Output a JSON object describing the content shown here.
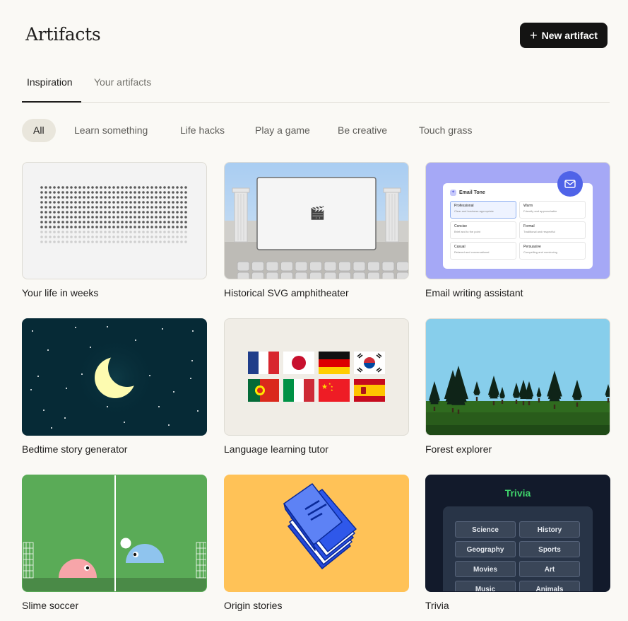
{
  "header": {
    "title": "Artifacts",
    "new_button_label": "New artifact",
    "new_button_icon": "plus-icon"
  },
  "tabs": [
    {
      "label": "Inspiration",
      "active": true
    },
    {
      "label": "Your artifacts",
      "active": false
    }
  ],
  "filters": [
    {
      "label": "All",
      "active": true
    },
    {
      "label": "Learn something",
      "active": false
    },
    {
      "label": "Life hacks",
      "active": false
    },
    {
      "label": "Play a game",
      "active": false
    },
    {
      "label": "Be creative",
      "active": false
    },
    {
      "label": "Touch grass",
      "active": false
    }
  ],
  "cards": [
    {
      "title": "Your life in weeks"
    },
    {
      "title": "Historical SVG amphitheater",
      "emoji": "🎬"
    },
    {
      "title": "Email writing assistant",
      "email_card": {
        "heading": "Email Tone",
        "options": [
          {
            "name": "Professional",
            "desc": "Clear and business-appropriate"
          },
          {
            "name": "Warm",
            "desc": "Friendly and approachable"
          },
          {
            "name": "Concise",
            "desc": "Brief and to the point"
          },
          {
            "name": "Formal",
            "desc": "Traditional and respectful"
          },
          {
            "name": "Casual",
            "desc": "Relaxed and conversational"
          },
          {
            "name": "Persuasive",
            "desc": "Compelling and convincing"
          }
        ]
      }
    },
    {
      "title": "Bedtime story generator"
    },
    {
      "title": "Language learning tutor"
    },
    {
      "title": "Forest explorer"
    },
    {
      "title": "Slime soccer"
    },
    {
      "title": "Origin stories"
    },
    {
      "title": "Trivia",
      "trivia": {
        "heading": "Trivia",
        "categories": [
          "Science",
          "History",
          "Geography",
          "Sports",
          "Movies",
          "Art",
          "Music",
          "Animals"
        ]
      }
    }
  ],
  "colors": {
    "background": "#faf9f5",
    "button": "#141413",
    "chip_active": "#e9e6dc",
    "email_bg": "#a5a8f6",
    "night_sky": "#062a36",
    "trivia_accent": "#3fd36b"
  }
}
